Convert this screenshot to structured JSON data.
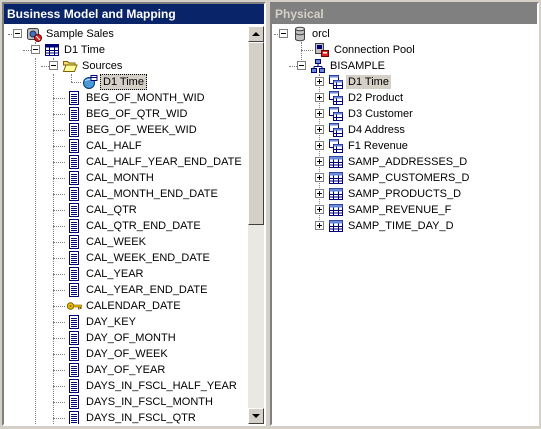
{
  "left_pane": {
    "title": "Business Model and Mapping",
    "tree": {
      "root": "Sample Sales",
      "table": "D1 Time",
      "sources_folder": "Sources",
      "source": "D1 Time",
      "columns": [
        "BEG_OF_MONTH_WID",
        "BEG_OF_QTR_WID",
        "BEG_OF_WEEK_WID",
        "CAL_HALF",
        "CAL_HALF_YEAR_END_DATE",
        "CAL_MONTH",
        "CAL_MONTH_END_DATE",
        "CAL_QTR",
        "CAL_QTR_END_DATE",
        "CAL_WEEK",
        "CAL_WEEK_END_DATE",
        "CAL_YEAR",
        "CAL_YEAR_END_DATE",
        "CALENDAR_DATE",
        "DAY_KEY",
        "DAY_OF_MONTH",
        "DAY_OF_WEEK",
        "DAY_OF_YEAR",
        "DAYS_IN_FSCL_HALF_YEAR",
        "DAYS_IN_FSCL_MONTH",
        "DAYS_IN_FSCL_QTR"
      ],
      "key_column": "CALENDAR_DATE"
    },
    "scrollbar": {
      "position": 0.0,
      "visible_fraction": 0.47
    }
  },
  "right_pane": {
    "title": "Physical",
    "tree": {
      "database": "orcl",
      "connection_pool": "Connection Pool",
      "schema": "BISAMPLE",
      "aliases": [
        "D1 Time",
        "D2 Product",
        "D3 Customer",
        "D4 Address",
        "F1 Revenue"
      ],
      "tables": [
        "SAMP_ADDRESSES_D",
        "SAMP_CUSTOMERS_D",
        "SAMP_PRODUCTS_D",
        "SAMP_REVENUE_F",
        "SAMP_TIME_DAY_D"
      ]
    }
  },
  "colors": {
    "active_title": "#0a246a",
    "inactive_title": "#808080",
    "window_bg": "#d4d0c8"
  }
}
